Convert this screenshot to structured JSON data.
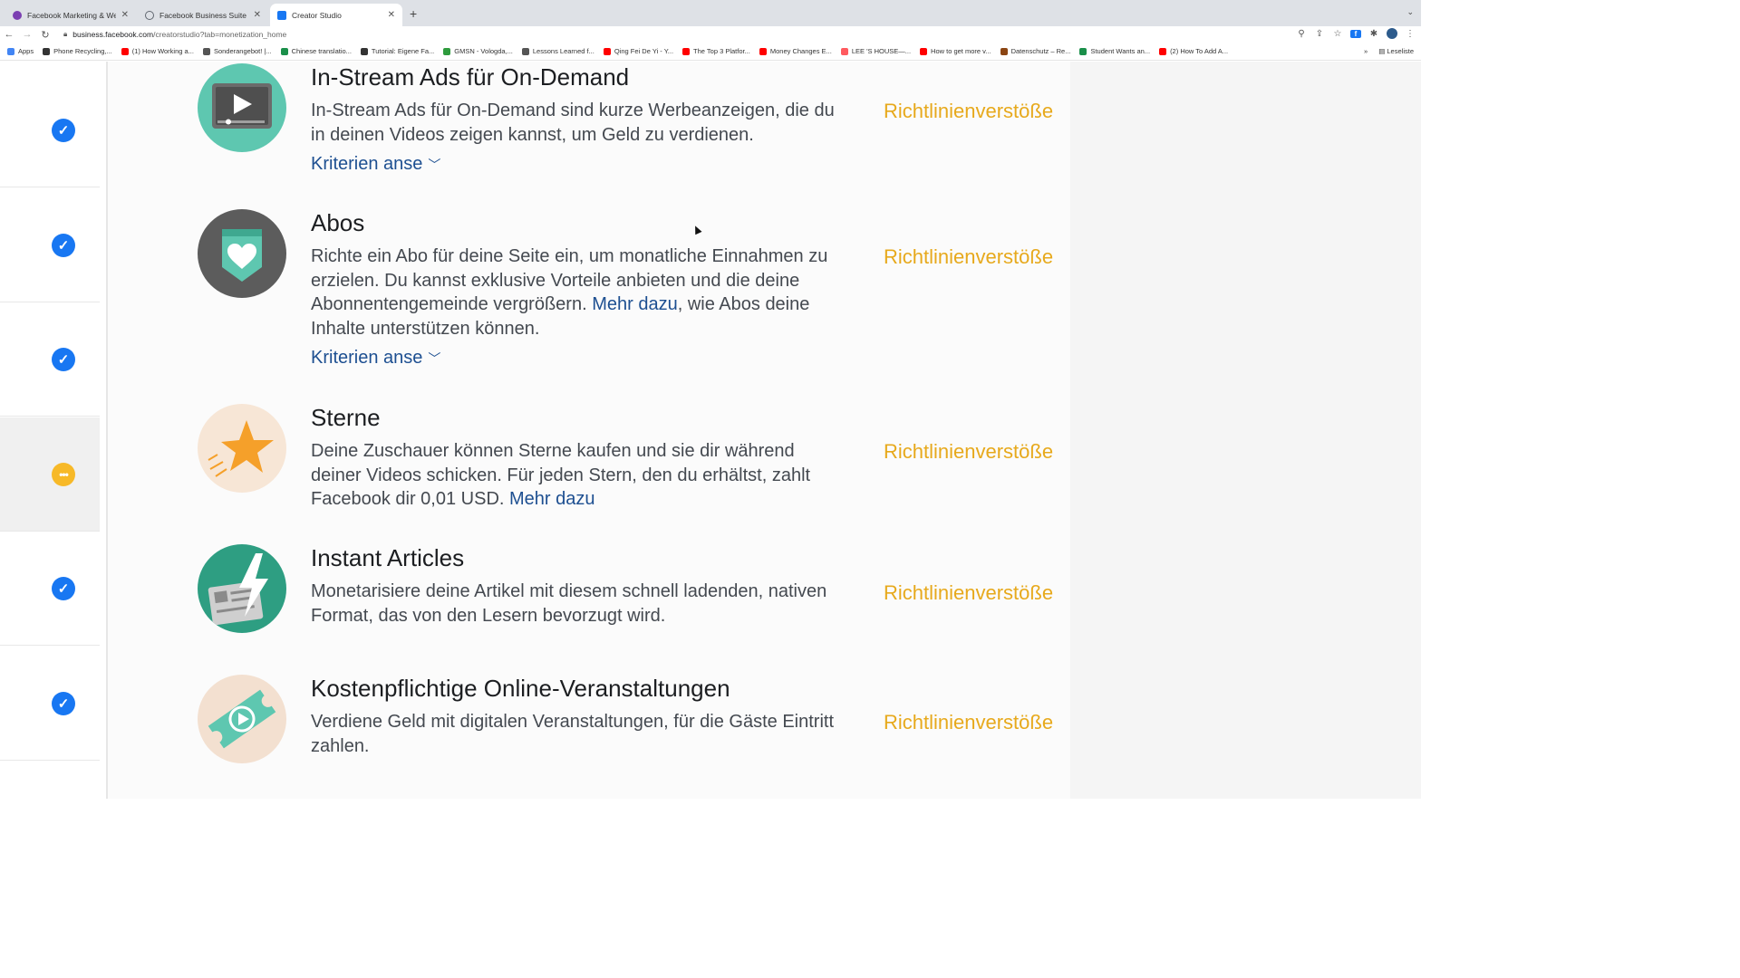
{
  "browser": {
    "tabs": [
      {
        "title": "Facebook Marketing & Werbea",
        "favicon_color": "#7b3fb2"
      },
      {
        "title": "Facebook Business Suite",
        "favicon_color": "#606770"
      },
      {
        "title": "Creator Studio",
        "favicon_color": "#1877f2",
        "active": true
      }
    ],
    "new_tab_symbol": "+",
    "url_host": "business.facebook.com",
    "url_path": "/creatorstudio?tab=monetization_home",
    "bookmarks": [
      {
        "label": "Apps",
        "icon": "apps-grid-icon",
        "color": "#4285f4"
      },
      {
        "label": "Phone Recycling,...",
        "icon": "search-icon",
        "color": "#333333"
      },
      {
        "label": "(1) How Working a...",
        "icon": "youtube-icon",
        "color": "#ff0000"
      },
      {
        "label": "Sonderangebot! |...",
        "icon": "shop-icon",
        "color": "#555555"
      },
      {
        "label": "Chinese translatio...",
        "icon": "globe-icon",
        "color": "#1a8f4a"
      },
      {
        "label": "Tutorial: Eigene Fa...",
        "icon": "hash-icon",
        "color": "#333333"
      },
      {
        "label": "GMSN - Vologda,...",
        "icon": "circle-icon",
        "color": "#2e9b3d"
      },
      {
        "label": "Lessons Learned f...",
        "icon": "tool-icon",
        "color": "#555555"
      },
      {
        "label": "Qing Fei De Yi - Y...",
        "icon": "youtube-icon",
        "color": "#ff0000"
      },
      {
        "label": "The Top 3 Platfor...",
        "icon": "youtube-icon",
        "color": "#ff0000"
      },
      {
        "label": "Money Changes E...",
        "icon": "youtube-icon",
        "color": "#ff0000"
      },
      {
        "label": "LEE 'S HOUSE—...",
        "icon": "airbnb-icon",
        "color": "#ff5a5f"
      },
      {
        "label": "How to get more v...",
        "icon": "youtube-icon",
        "color": "#ff0000"
      },
      {
        "label": "Datenschutz – Re...",
        "icon": "doc-icon",
        "color": "#8b4513"
      },
      {
        "label": "Student Wants an...",
        "icon": "circle-icon",
        "color": "#1a8f4a"
      },
      {
        "label": "(2) How To Add A...",
        "icon": "youtube-icon",
        "color": "#ff0000"
      }
    ],
    "bookmarks_overflow": "»",
    "reading_list": "Leseliste"
  },
  "sidebar_status": [
    {
      "state": "ok",
      "glyph": "✓"
    },
    {
      "state": "ok",
      "glyph": "✓"
    },
    {
      "state": "ok",
      "glyph": "✓"
    },
    {
      "state": "pending",
      "glyph": "•••"
    },
    {
      "state": "ok",
      "glyph": "✓"
    },
    {
      "state": "ok",
      "glyph": "✓"
    }
  ],
  "features": [
    {
      "title": "In-Stream Ads für On-Demand",
      "description": "In-Stream Ads für On-Demand sind kurze Werbeanzeigen, die du in deinen Videos zeigen kannst, um Geld zu verdienen.",
      "criteria_label": "Kriterien anse",
      "status": "Richtlinienverstöße"
    },
    {
      "title": "Abos",
      "description_before": "Richte ein Abo für deine Seite ein, um monatliche Einnahmen zu erzielen. Du kannst exklusive Vorteile anbieten und die deine Abonnentengemeinde vergrößern. ",
      "link": "Mehr dazu",
      "description_after": ", wie Abos deine Inhalte unterstützen können.",
      "criteria_label": "Kriterien anse",
      "status": "Richtlinienverstöße"
    },
    {
      "title": "Sterne",
      "description_before": "Deine Zuschauer können Sterne kaufen und sie dir während deiner Videos schicken. Für jeden Stern, den du erhältst, zahlt Facebook dir 0,01 USD. ",
      "link": "Mehr dazu",
      "status": "Richtlinienverstöße"
    },
    {
      "title": "Instant Articles",
      "description": "Monetarisiere deine Artikel mit diesem schnell ladenden, nativen Format, das von den Lesern bevorzugt wird.",
      "status": "Richtlinienverstöße"
    },
    {
      "title": "Kostenpflichtige Online-Veranstaltungen",
      "description": "Verdiene Geld mit digitalen Veranstaltungen, für die Gäste Eintritt zahlen.",
      "status": "Richtlinienverstöße"
    }
  ],
  "colors": {
    "accent_blue": "#1877f2",
    "status_orange": "#e7a91c",
    "link_blue": "#1d4f91",
    "pending_yellow": "#f7b928"
  }
}
